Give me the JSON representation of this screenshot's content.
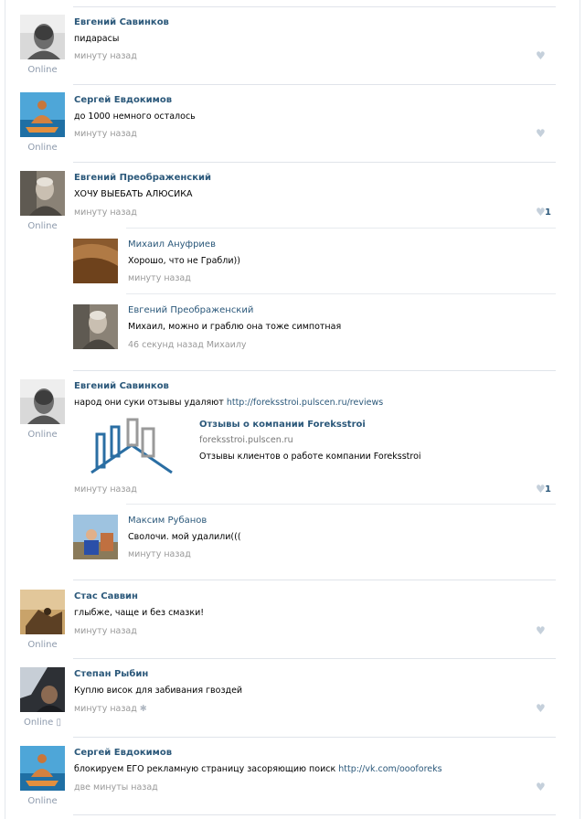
{
  "posts": [
    {
      "author": "Евгений Савинков",
      "text": "пидарасы",
      "time": "минуту назад",
      "status": "Online"
    },
    {
      "author": "Сергей Евдокимов",
      "text": "до 1000 немного осталось",
      "time": "минуту назад",
      "status": "Online"
    },
    {
      "author": "Евгений Преображенский",
      "text": "ХОЧУ ВЫЕБАТЬ АЛЮСИКА",
      "time": "минуту назад",
      "status": "Online",
      "likes": "1",
      "replies": [
        {
          "author": "Михаил Ануфриев",
          "text": "Хорошо, что не Грабли))",
          "time": "минуту назад"
        },
        {
          "author": "Евгений Преображенский",
          "text": "Михаил, можно и граблю она тоже симпотная",
          "time": "46 секунд назад Михаилу"
        }
      ]
    },
    {
      "author": "Евгений Савинков",
      "text": "народ они суки отзывы удаляют ",
      "link": "http://foreksstroi.pulscen.ru/reviews",
      "time": "минуту назад",
      "status": "Online",
      "likes": "1",
      "snippet": {
        "title": "Отзывы о компании Foreksstroi",
        "domain": "foreksstroi.pulscen.ru",
        "description": "Отзывы клиентов о работе компании Foreksstroi"
      },
      "replies": [
        {
          "author": "Максим Рубанов",
          "text": "Сволочи. мой удалили(((",
          "time": "минуту назад"
        }
      ]
    },
    {
      "author": "Стас Саввин",
      "text": "глыбже, чаще и без смазки!",
      "time": "минуту назад",
      "status": "Online"
    },
    {
      "author": "Степан Рыбин",
      "text": "Куплю висок для забивания гвоздей",
      "time": "минуту назад",
      "status": "Online"
    },
    {
      "author": "Сергей Евдокимов",
      "text": "блокируем ЕГО рекламную страницу засоряющию поиск ",
      "link": "http://vk.com/oooforeks",
      "time": "две минуты назад",
      "status": "Online"
    }
  ],
  "icons": {
    "like": "heart-icon",
    "android": "android-icon",
    "mobile": "mobile-icon"
  },
  "colors": {
    "name": "#2b587a",
    "muted": "#999999",
    "online": "#8d9aac",
    "like": "#c5d0db"
  }
}
